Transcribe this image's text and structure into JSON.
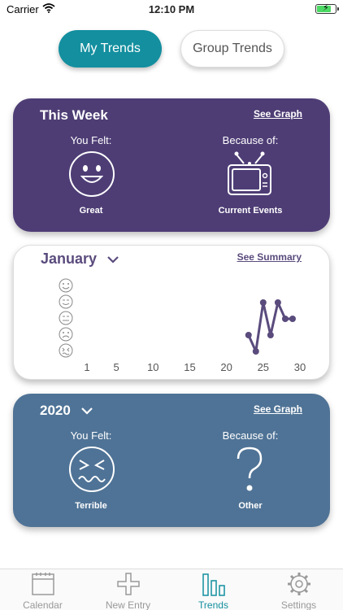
{
  "status": {
    "carrier": "Carrier",
    "time": "12:10 PM",
    "battery_level": 0.8
  },
  "toggle": {
    "active_label": "My Trends",
    "inactive_label": "Group Trends"
  },
  "week": {
    "title": "This Week",
    "link": "See Graph",
    "felt_label": "You Felt:",
    "because_label": "Because of:",
    "feeling": "Great",
    "reason": "Current Events",
    "feeling_icon": "happy-face-icon",
    "reason_icon": "tv-icon"
  },
  "month": {
    "title": "January",
    "link": "See Summary",
    "chart_data": {
      "type": "line",
      "x": [
        23,
        24,
        25,
        26,
        27,
        28,
        29
      ],
      "y": [
        2,
        1,
        4,
        2,
        4,
        3,
        3
      ],
      "xlim": [
        0,
        30
      ],
      "ylim": [
        1,
        5
      ],
      "x_ticks": [
        "1",
        "5",
        "10",
        "15",
        "20",
        "25",
        "30"
      ],
      "y_ticks": [
        "happy-face-icon",
        "smile-face-icon",
        "neutral-face-icon",
        "sad-face-icon",
        "cry-face-icon"
      ],
      "color": "#5a4b7d"
    }
  },
  "year": {
    "title": "2020",
    "link": "See Graph",
    "felt_label": "You Felt:",
    "because_label": "Because of:",
    "feeling": "Terrible",
    "reason": "Other",
    "feeling_icon": "crying-face-icon",
    "reason_icon": "question-mark-icon"
  },
  "tabs": [
    {
      "label": "Calendar",
      "icon": "calendar-icon"
    },
    {
      "label": "New Entry",
      "icon": "plus-icon"
    },
    {
      "label": "Trends",
      "icon": "bar-chart-icon",
      "active": true
    },
    {
      "label": "Settings",
      "icon": "gear-icon"
    }
  ],
  "colors": {
    "accent": "#138f9f",
    "week_card": "#4e3d75",
    "year_card": "#4f7396"
  }
}
